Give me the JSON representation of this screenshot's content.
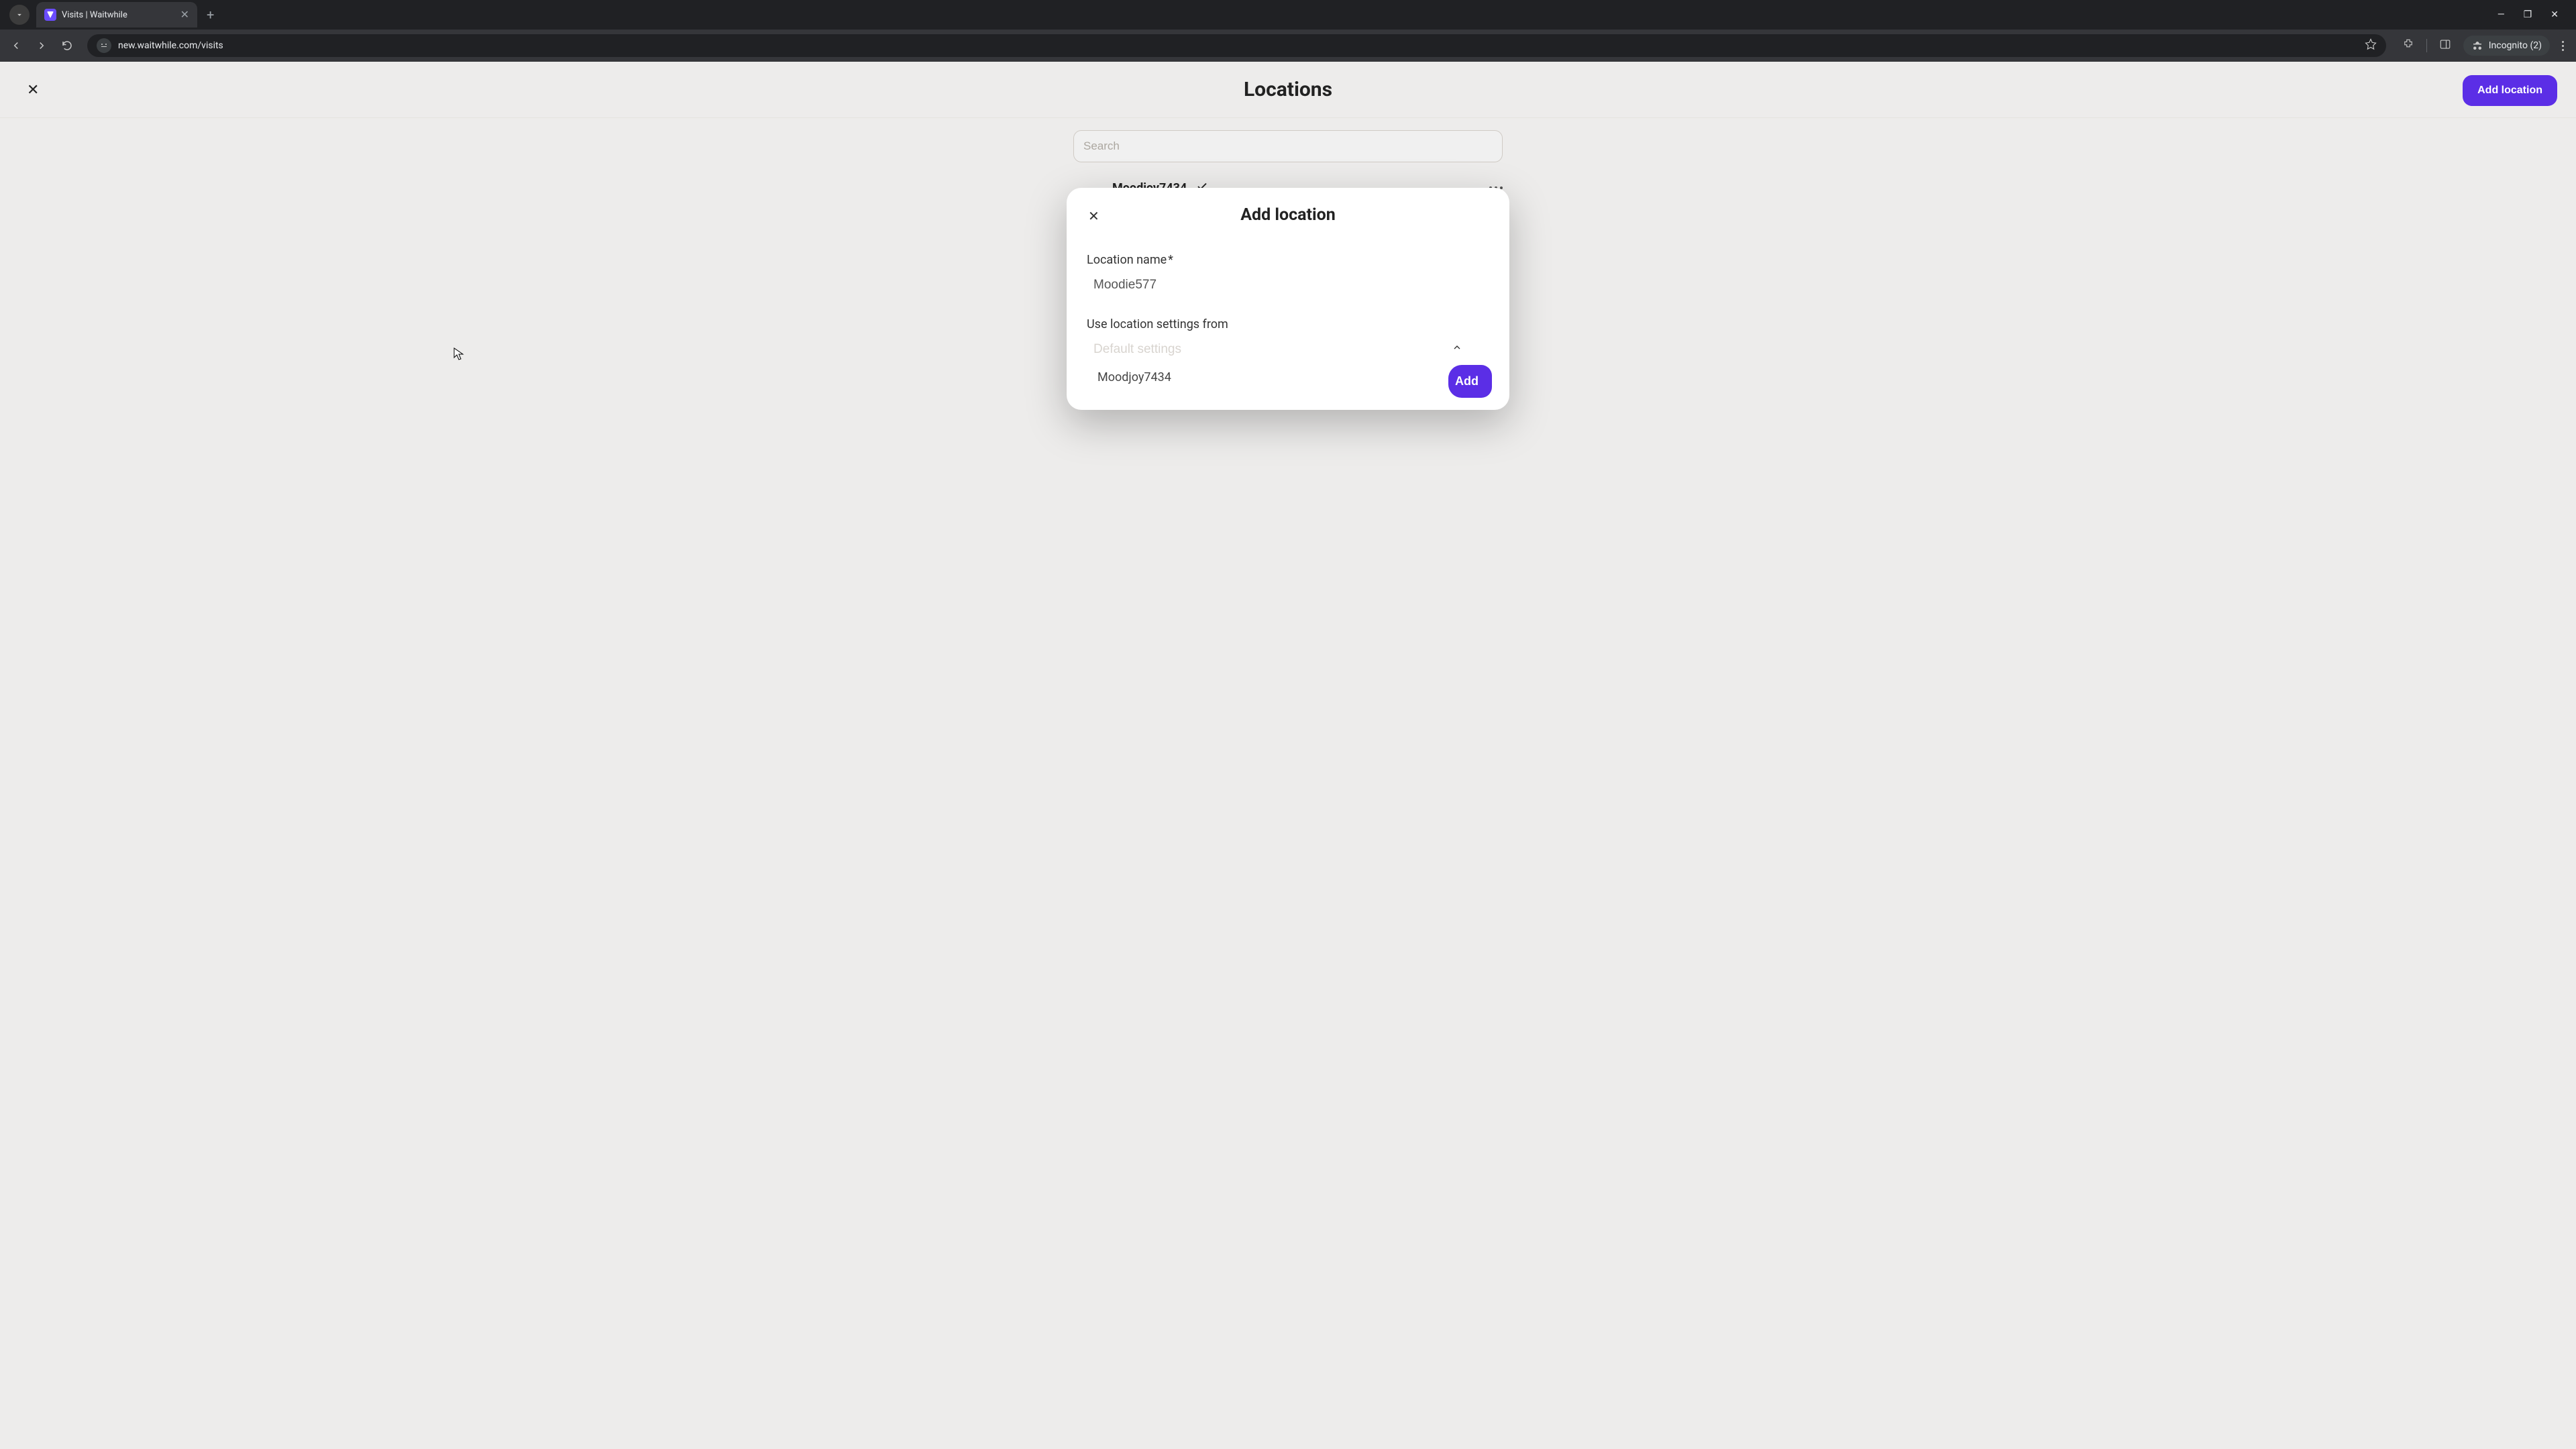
{
  "browser": {
    "tab_title": "Visits | Waitwhile",
    "url": "new.waitwhile.com/visits",
    "incognito_label": "Incognito (2)"
  },
  "header": {
    "title": "Locations",
    "add_button": "Add location"
  },
  "search": {
    "placeholder": "Search"
  },
  "location_item": {
    "name": "Moodjoy7434"
  },
  "modal": {
    "title": "Add location",
    "name_label": "Location name",
    "name_required": "*",
    "name_value": "Moodie577",
    "settings_label": "Use location settings from",
    "settings_placeholder": "Default settings",
    "settings_option": "Moodjoy7434",
    "submit_label": "Add"
  }
}
